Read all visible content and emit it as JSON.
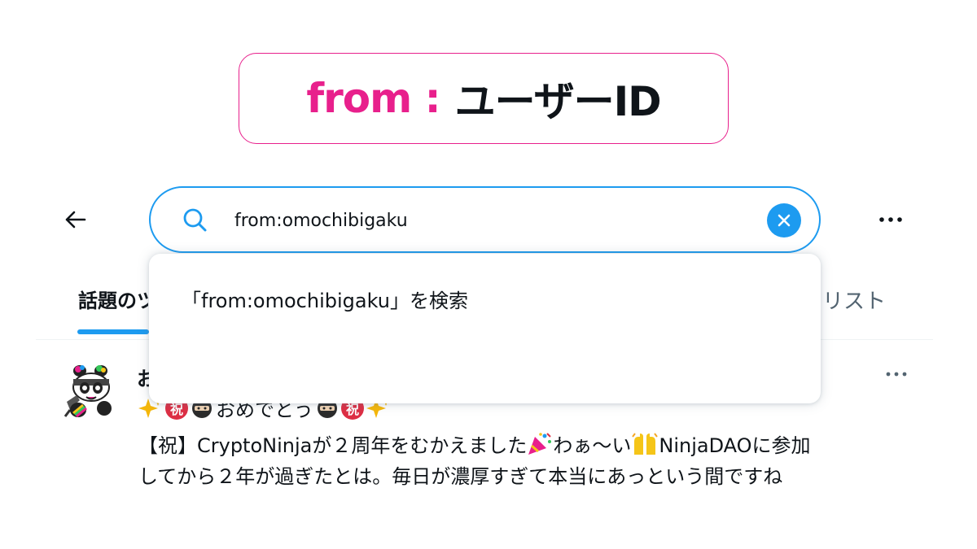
{
  "title_card": {
    "prefix": "from :",
    "label": "ユーザーID",
    "accent_color": "#e8208c"
  },
  "header": {
    "back_icon": "arrow-left-icon",
    "search": {
      "value": "from:omochibigaku",
      "icon": "search-icon",
      "clear_icon": "close-icon"
    },
    "more_icon": "more-horizontal-icon"
  },
  "dropdown": {
    "suggestion": "「from:omochibigaku」を検索"
  },
  "tabs": {
    "trending": "話題のツ",
    "lists": "リスト",
    "active_color": "#1d9bf0"
  },
  "tweet": {
    "author": "お",
    "line1_text": "おめでとう",
    "line2_a": "【祝】CryptoNinjaが２周年をむかえました",
    "line2_b": "わぁ～い",
    "line2_c": "NinjaDAOに参加",
    "line3": "してから２年が過ぎたとは。毎日が濃厚すぎて本当にあっという間ですね",
    "celebrate_char": "祝",
    "more_icon": "more-horizontal-icon"
  }
}
